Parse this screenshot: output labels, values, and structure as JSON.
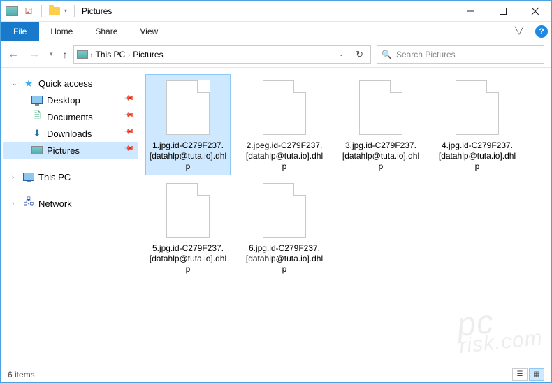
{
  "window": {
    "title": "Pictures"
  },
  "ribbon": {
    "file": "File",
    "tabs": [
      "Home",
      "Share",
      "View"
    ]
  },
  "breadcrumbs": [
    "This PC",
    "Pictures"
  ],
  "search": {
    "placeholder": "Search Pictures"
  },
  "sidebar": {
    "quick_access": "Quick access",
    "items": [
      {
        "label": "Desktop",
        "pinned": true
      },
      {
        "label": "Documents",
        "pinned": true
      },
      {
        "label": "Downloads",
        "pinned": true
      },
      {
        "label": "Pictures",
        "pinned": true,
        "selected": true
      }
    ],
    "this_pc": "This PC",
    "network": "Network"
  },
  "files": [
    {
      "name": "1.jpg.id-C279F237.[datahlp@tuta.io].dhlp",
      "selected": true
    },
    {
      "name": "2.jpeg.id-C279F237.[datahlp@tuta.io].dhlp"
    },
    {
      "name": "3.jpg.id-C279F237.[datahlp@tuta.io].dhlp"
    },
    {
      "name": "4.jpg.id-C279F237.[datahlp@tuta.io].dhlp"
    },
    {
      "name": "5.jpg.id-C279F237.[datahlp@tuta.io].dhlp"
    },
    {
      "name": "6.jpg.id-C279F237.[datahlp@tuta.io].dhlp"
    }
  ],
  "status": {
    "count": "6 items"
  },
  "watermark": {
    "top": "pc",
    "bottom": "risk.com"
  }
}
